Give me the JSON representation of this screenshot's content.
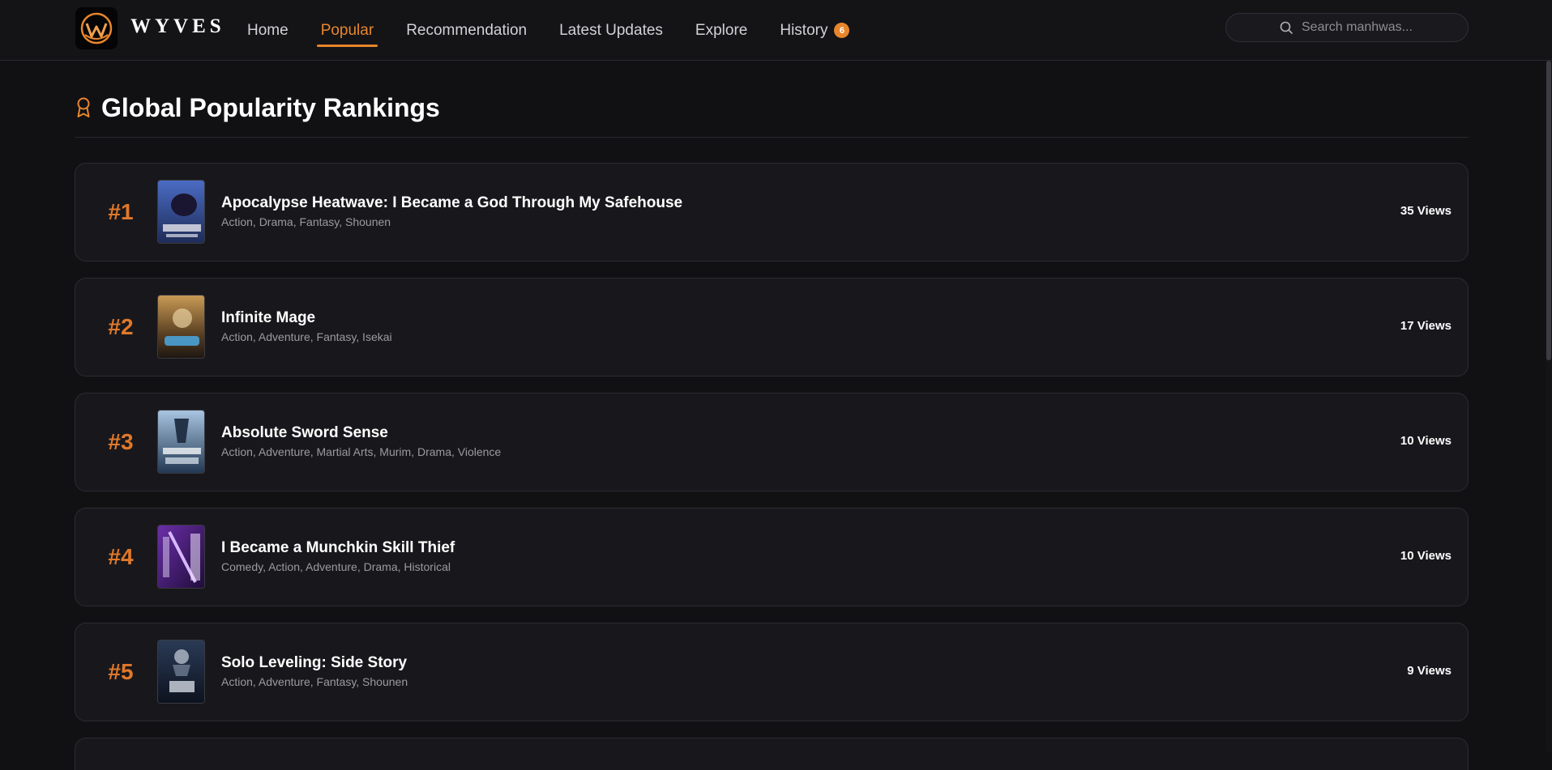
{
  "brand": {
    "name": "WYVES",
    "logo_icon": "wyves-logo-icon"
  },
  "nav": {
    "items": [
      {
        "label": "Home",
        "active": false
      },
      {
        "label": "Popular",
        "active": true
      },
      {
        "label": "Recommendation",
        "active": false
      },
      {
        "label": "Latest Updates",
        "active": false
      },
      {
        "label": "Explore",
        "active": false
      },
      {
        "label": "History",
        "active": false,
        "badge": "6"
      }
    ]
  },
  "search": {
    "placeholder": "Search manhwas...",
    "value": "",
    "icon": "search-icon"
  },
  "page": {
    "title": "Global Popularity Rankings",
    "icon": "award-icon"
  },
  "rankings": [
    {
      "rank": "#1",
      "title": "Apocalypse Heatwave: I Became a God Through My Safehouse",
      "genres": "Action, Drama, Fantasy, Shounen",
      "views": "35 Views"
    },
    {
      "rank": "#2",
      "title": "Infinite Mage",
      "genres": "Action, Adventure, Fantasy, Isekai",
      "views": "17 Views"
    },
    {
      "rank": "#3",
      "title": "Absolute Sword Sense",
      "genres": "Action, Adventure, Martial Arts, Murim, Drama, Violence",
      "views": "10 Views"
    },
    {
      "rank": "#4",
      "title": "I Became a Munchkin Skill Thief",
      "genres": "Comedy, Action, Adventure, Drama, Historical",
      "views": "10 Views"
    },
    {
      "rank": "#5",
      "title": "Solo Leveling: Side Story",
      "genres": "Action, Adventure, Fantasy, Shounen",
      "views": "9 Views"
    }
  ],
  "colors": {
    "accent": "#e8862c",
    "background": "#111114",
    "card": "#18181c"
  }
}
